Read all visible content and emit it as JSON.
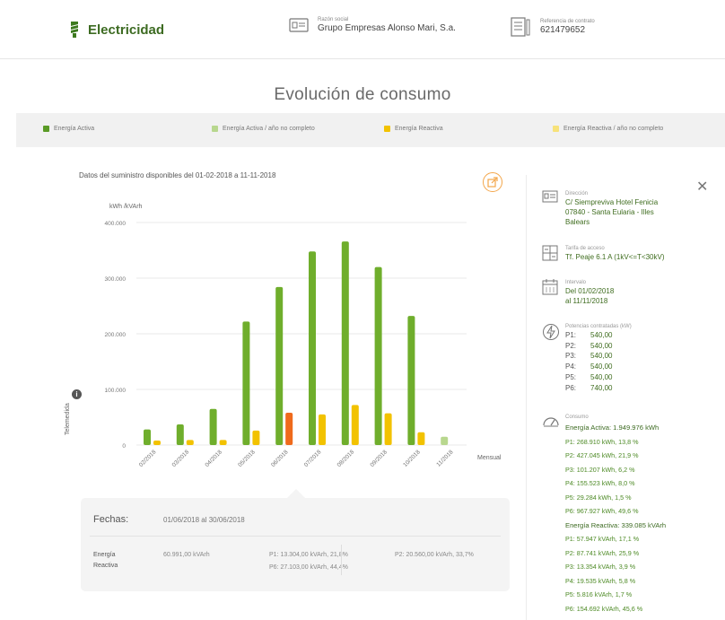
{
  "header": {
    "title": "Electricidad",
    "razon_caption": "Razón social",
    "razon_value": "Grupo Empresas Alonso Mari, S.a.",
    "contrato_caption": "Referencia de contrato",
    "contrato_value": "621479652"
  },
  "page_title": "Evolución de consumo",
  "legend": [
    {
      "label": "Energía Activa",
      "color": "#5a9b26"
    },
    {
      "label": "Energía Activa / año no completo",
      "color": "#b8d78e"
    },
    {
      "label": "Energía Reactiva",
      "color": "#f2c200"
    },
    {
      "label": "Energía Reactiva / año no completo",
      "color": "#f7e27a"
    }
  ],
  "chart_header": "Datos del suministro disponibles del 01-02-2018 a 11-11-2018",
  "chart_data": {
    "type": "bar",
    "ylabel": "kWh /kVArh",
    "xlabel": "Mensual",
    "side_label": "Telemedida",
    "ylim": [
      0,
      400000
    ],
    "yticks": [
      "400.000",
      "300.000",
      "200.000",
      "100.000",
      "0"
    ],
    "categories": [
      "02/2018",
      "03/2018",
      "04/2018",
      "05/2018",
      "06/2018",
      "07/2018",
      "08/2018",
      "09/2018",
      "10/2018",
      "11/2018"
    ],
    "series": [
      {
        "name": "Energía Activa",
        "color": "#6fae2c",
        "values": [
          28000,
          37000,
          65000,
          222000,
          284000,
          348000,
          366000,
          320000,
          232000,
          15000
        ]
      },
      {
        "name": "Energía Reactiva",
        "color": "#f2c200",
        "values": [
          8000,
          9000,
          9000,
          26000,
          58000,
          55000,
          72000,
          57000,
          23000,
          0
        ]
      }
    ],
    "highlight": {
      "category": "06/2018",
      "series": "Energía Reactiva",
      "color": "#ef6a1c"
    },
    "incomplete_category": "11/2018",
    "incomplete_color": "#b8d78e"
  },
  "detail": {
    "label": "Fechas:",
    "range": "01/06/2018 al 30/06/2018",
    "energy_label_1": "Energía",
    "energy_label_2": "Reactiva",
    "total": "60.991,00 kVArh",
    "p1": "P1: 13.304,00 kVArh, 21,8%",
    "p2": "P2: 20.560,00 kVArh, 33,7%",
    "p6": "P6: 27.103,00 kVArh, 44,4%"
  },
  "side": {
    "direccion_caption": "Dirección",
    "direccion_lines": [
      "C/ Siempreviva Hotel Fenicia",
      "07840 - Santa Eularia - Illes",
      "Balears"
    ],
    "tarifa_caption": "Tarifa de acceso",
    "tarifa_value": "Tf. Peaje 6.1 A (1kV<=T<30kV)",
    "intervalo_caption": "Intervalo",
    "intervalo_lines": [
      "Del 01/02/2018",
      "al 11/11/2018"
    ],
    "potencias_caption": "Potencias contratadas (kW)",
    "potencias": [
      {
        "k": "P1:",
        "v": "540,00"
      },
      {
        "k": "P2:",
        "v": "540,00"
      },
      {
        "k": "P3:",
        "v": "540,00"
      },
      {
        "k": "P4:",
        "v": "540,00"
      },
      {
        "k": "P5:",
        "v": "540,00"
      },
      {
        "k": "P6:",
        "v": "740,00"
      }
    ],
    "consumo_caption": "Consumo",
    "consumo_lines": [
      "Energía Activa: 1.949.976 kWh",
      "P1: 268.910 kWh, 13,8 %",
      "P2: 427.045 kWh, 21,9 %",
      "P3: 101.207 kWh, 6,2 %",
      "P4: 155.523 kWh, 8,0 %",
      "P5: 29.284 kWh, 1,5 %",
      "P6: 967.927 kWh, 49,6 %",
      "Energía Reactiva: 339.085 kVArh",
      "P1: 57.947 kVArh, 17,1 %",
      "P2: 87.741 kVArh, 25,9 %",
      "P3: 13.354 kVArh, 3,9 %",
      "P4: 19.535 kVArh, 5,8 %",
      "P5: 5.816 kVArh, 1,7 %",
      "P6: 154.692 kVArh, 45,6 %"
    ]
  }
}
